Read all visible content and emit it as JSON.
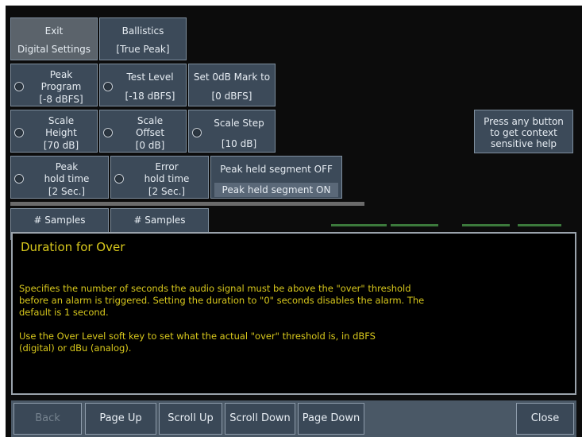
{
  "menu": {
    "exit": {
      "line1": "Exit",
      "line2": "Digital Settings"
    },
    "ballistics": {
      "line1": "Ballistics",
      "line2": "[True Peak]"
    },
    "peak_program": {
      "line1": "Peak",
      "line2": "Program",
      "line3": "[-8 dBFS]"
    },
    "test_level": {
      "line1": "Test Level",
      "line2": "[-18 dBFS]"
    },
    "set_0db": {
      "line1": "Set 0dB Mark to",
      "line2": "[0 dBFS]"
    },
    "scale_height": {
      "line1": "Scale",
      "line2": "Height",
      "line3": "[70 dB]"
    },
    "scale_offset": {
      "line1": "Scale",
      "line2": "Offset",
      "line3": "[0 dB]"
    },
    "scale_step": {
      "line1": "Scale Step",
      "line2": "[10 dB]"
    },
    "peak_hold": {
      "line1": "Peak",
      "line2": "hold time",
      "line3": "[2 Sec.]"
    },
    "error_hold": {
      "line1": "Error",
      "line2": "hold time",
      "line3": "[2 Sec.]"
    },
    "peak_held": {
      "option_off": "Peak held segment OFF",
      "option_on": "Peak held segment ON",
      "selected": "Peak held segment ON"
    },
    "samples_1": {
      "line1": "# Samples"
    },
    "samples_2": {
      "line1": "# Samples"
    }
  },
  "context_help_button": {
    "line1": "Press any button",
    "line2": "to get context",
    "line3": "sensitive help"
  },
  "help_panel": {
    "title": "Duration for Over",
    "paragraph1": "Specifies the number of seconds the audio signal must be above the \"over\" threshold\nbefore an alarm is triggered. Setting the duration to \"0\" seconds disables the alarm. The\ndefault is 1 second.",
    "paragraph2": "Use the Over Level soft key to set what the actual \"over\" threshold is, in dBFS\n(digital) or dBu (analog)."
  },
  "footer": {
    "back": "Back",
    "page_up": "Page Up",
    "scroll_up": "Scroll Up",
    "scroll_down": "Scroll Down",
    "page_down": "Page Down",
    "close": "Close"
  },
  "colors": {
    "help_text": "#d8c81c",
    "button_fill": "#3c4a59",
    "screen_bg": "#0c0c0c",
    "meter_green": "#3c7a3c"
  }
}
